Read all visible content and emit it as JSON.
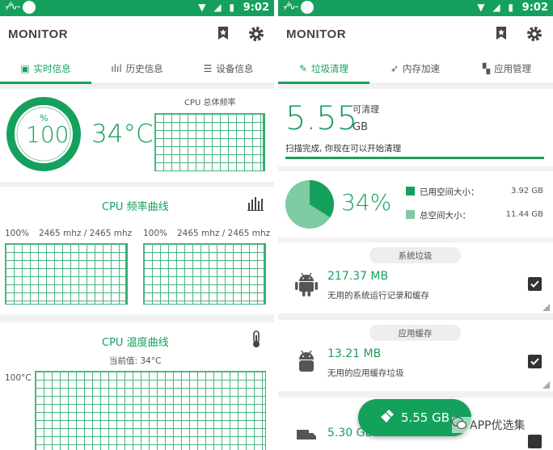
{
  "status": {
    "time": "9:02"
  },
  "app": {
    "title": "MONITOR"
  },
  "left": {
    "tabs": [
      {
        "label": "实时信息",
        "active": true
      },
      {
        "label": "历史信息",
        "active": false
      },
      {
        "label": "设备信息",
        "active": false
      }
    ],
    "gauge": {
      "unit": "%",
      "value": "100",
      "fraction": 1.0
    },
    "temperature": "34°C",
    "cpu_freq_title": "CPU 总体频率",
    "freq_curve": {
      "title": "CPU 频率曲线",
      "cores": [
        {
          "percent": "100%",
          "freq": "2465 mhz / 2465 mhz"
        },
        {
          "percent": "100%",
          "freq": "2465 mhz / 2465 mhz"
        }
      ]
    },
    "temp_curve": {
      "title": "CPU 温度曲线",
      "current_label": "当前值: 34°C",
      "y_max": "100°C"
    }
  },
  "right": {
    "tabs": [
      {
        "label": "垃圾清理",
        "active": true
      },
      {
        "label": "内存加速",
        "active": false
      },
      {
        "label": "应用管理",
        "active": false
      }
    ],
    "clean": {
      "size": "5.55",
      "caption": "可清理",
      "unit": "GB",
      "status": "扫描完成, 你现在可以开始清理"
    },
    "storage": {
      "percent": "34%",
      "used_fraction": 0.34,
      "used_label": "已用空间大小：",
      "used_value": "3.92 GB",
      "total_label": "总空间大小：",
      "total_value": "11.44 GB",
      "colors": {
        "used": "#16a05d",
        "free": "#7fcba3"
      }
    },
    "sections": [
      {
        "badge": "系统垃圾",
        "size": "217.37 MB",
        "desc": "无用的系统运行记录和缓存"
      },
      {
        "badge": "应用缓存",
        "size": "13.21 MB",
        "desc": "无用的应用缓存垃圾"
      }
    ],
    "partial_item": {
      "size": "5.30 GB"
    },
    "fab": {
      "label": "5.55 GB"
    },
    "watermark": "APP优选集"
  }
}
